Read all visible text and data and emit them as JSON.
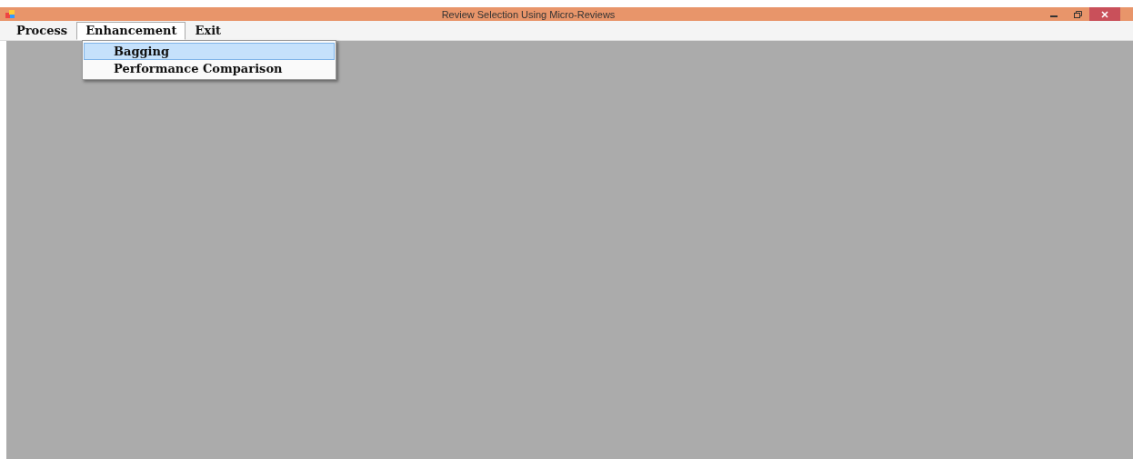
{
  "window": {
    "title": "Review Selection Using Micro-Reviews"
  },
  "menu_bar": [
    {
      "label": "Process",
      "expanded": false
    },
    {
      "label": "Enhancement",
      "expanded": true
    },
    {
      "label": "Exit",
      "expanded": false
    }
  ],
  "dropdown": {
    "items": [
      {
        "label": "Bagging",
        "selected": true
      },
      {
        "label": "Performance Comparison",
        "selected": false
      }
    ]
  }
}
